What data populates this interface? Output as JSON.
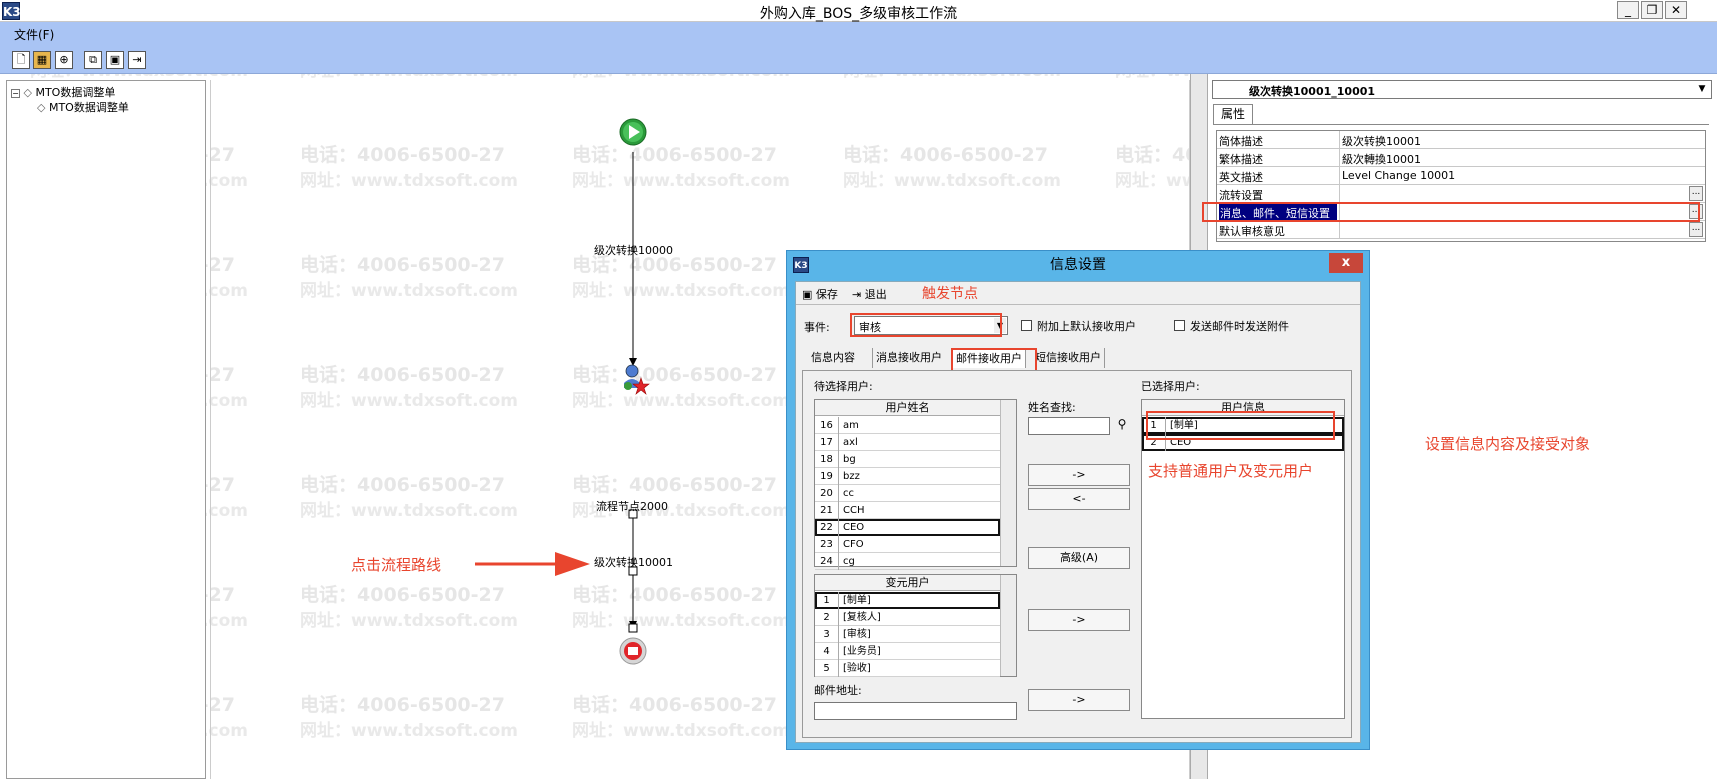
{
  "window": {
    "title": "外购入库_BOS_多级审核工作流",
    "app_icon": "K3"
  },
  "menu": {
    "file": "文件(F)"
  },
  "watermark": {
    "phone": "电话：4006-6500-27",
    "site": "网址：www.tdxsoft.com"
  },
  "tree": {
    "root": "MTO数据调整单",
    "child": "MTO数据调整单"
  },
  "flow": {
    "route_top": "级次转换10000",
    "node_mid": "流程节点2000",
    "route_bottom": "级次转换10001"
  },
  "right": {
    "node_select": "级次转换10001_10001",
    "tab": "属性",
    "props": [
      {
        "key": "简体描述",
        "value": "级次转换10001"
      },
      {
        "key": "繁体描述",
        "value": "級次轉換10001"
      },
      {
        "key": "英文描述",
        "value": "Level Change 10001"
      },
      {
        "key": "流转设置",
        "value": ""
      },
      {
        "key": "消息、邮件、短信设置",
        "value": ""
      },
      {
        "key": "默认审核意见",
        "value": ""
      }
    ]
  },
  "dialog": {
    "icon": "K3",
    "title": "信息设置",
    "close": "x",
    "save": "保存",
    "exit": "退出",
    "event_label": "事件:",
    "event_value": "审核",
    "attach_default": "附加上默认接收用户",
    "send_attachment": "发送邮件时发送附件",
    "tabs": [
      "信息内容",
      "消息接收用户",
      "邮件接收用户",
      "短信接收用户"
    ],
    "pending_label": "待选择用户:",
    "users_header": "用户姓名",
    "users": [
      {
        "n": "16",
        "name": "am"
      },
      {
        "n": "17",
        "name": "axl"
      },
      {
        "n": "18",
        "name": "bg"
      },
      {
        "n": "19",
        "name": "bzz"
      },
      {
        "n": "20",
        "name": "cc"
      },
      {
        "n": "21",
        "name": "CCH"
      },
      {
        "n": "22",
        "name": "CEO"
      },
      {
        "n": "23",
        "name": "CFO"
      },
      {
        "n": "24",
        "name": "cg"
      }
    ],
    "var_header": "变元用户",
    "var_users": [
      {
        "n": "1",
        "name": "[制单]"
      },
      {
        "n": "2",
        "name": "[复核人]"
      },
      {
        "n": "3",
        "name": "[审核]"
      },
      {
        "n": "4",
        "name": "[业务员]"
      },
      {
        "n": "5",
        "name": "[验收]"
      }
    ],
    "search_label": "姓名查找:",
    "btn_add": "->",
    "btn_remove": "<-",
    "btn_advanced": "高级(A)",
    "btn_add_var": "->",
    "btn_add_email": "->",
    "email_label": "邮件地址:",
    "selected_label": "已选择用户:",
    "selected_header": "用户信息",
    "selected": [
      {
        "n": "1",
        "name": "[制单]"
      },
      {
        "n": "2",
        "name": "CEO"
      }
    ]
  },
  "annotations": {
    "trigger": "触发节点",
    "click_route": "点击流程路线",
    "support": "支持普通用户及变元用户",
    "set_info": "设置信息内容及接受对象"
  },
  "colors": {
    "toolbar_bg": "#a9c4f4",
    "dialog_frame": "#59b5e8",
    "annotation": "#e8452e",
    "selection": "#000080"
  }
}
